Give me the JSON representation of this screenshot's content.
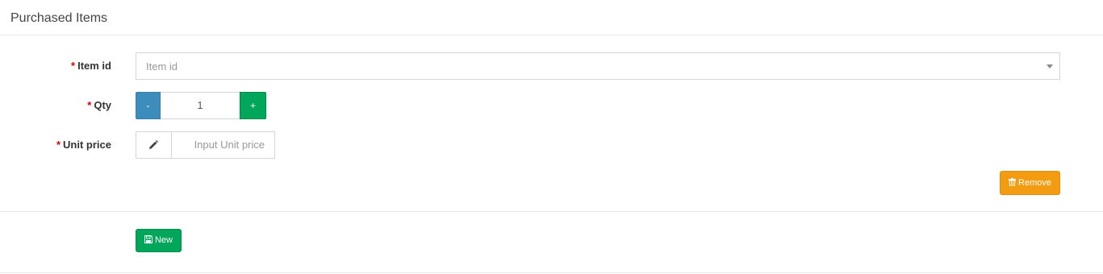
{
  "panel": {
    "title": "Purchased Items"
  },
  "form": {
    "required_mark": "*",
    "item_id": {
      "label": "Item id",
      "placeholder": "Item id"
    },
    "qty": {
      "label": "Qty",
      "minus_label": "-",
      "value": "1",
      "plus_label": "+"
    },
    "unit_price": {
      "label": "Unit price",
      "addon_icon": "pencil-icon",
      "placeholder": "Input Unit price"
    },
    "remove_button": {
      "icon": "trash-icon",
      "label": "Remove"
    }
  },
  "actions": {
    "new_button": {
      "icon": "save-icon",
      "label": "New"
    }
  },
  "colors": {
    "required": "#dd0000",
    "primary": "#3c8dbc",
    "success": "#00a65a",
    "warning": "#f39c12"
  }
}
